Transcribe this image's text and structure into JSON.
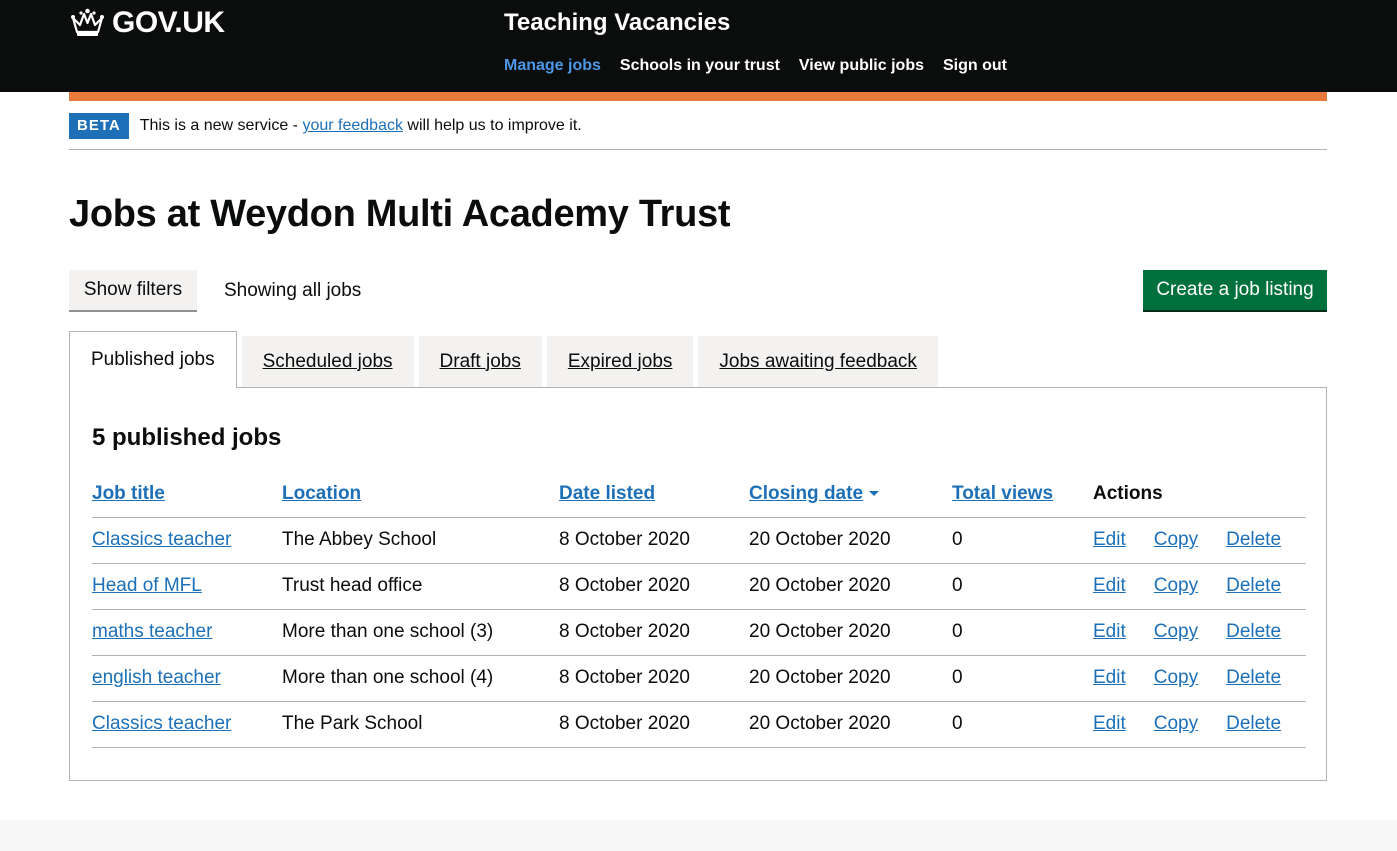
{
  "header": {
    "logo_text": "GOV.UK",
    "service_name": "Teaching Vacancies",
    "nav": [
      "Manage jobs",
      "Schools in your trust",
      "View public jobs",
      "Sign out"
    ],
    "active_nav": "Manage jobs"
  },
  "beta": {
    "tag": "BETA",
    "text_before": "This is a new service - ",
    "link": "your feedback",
    "text_after": " will help us to improve it."
  },
  "page_title": "Jobs at Weydon Multi Academy Trust",
  "filters": {
    "button": "Show filters",
    "status": "Showing all jobs"
  },
  "create_button": "Create a job listing",
  "tabs": [
    "Published jobs",
    "Scheduled jobs",
    "Draft jobs",
    "Expired jobs",
    "Jobs awaiting feedback"
  ],
  "active_tab": "Published jobs",
  "panel": {
    "title": "5 published jobs",
    "columns": [
      "Job title",
      "Location",
      "Date listed",
      "Closing date",
      "Total views",
      "Actions"
    ],
    "sorted_column": "Closing date",
    "rows": [
      {
        "title": "Classics teacher",
        "location": "The Abbey School",
        "listed": "8 October 2020",
        "closing": "20 October 2020",
        "views": "0"
      },
      {
        "title": "Head of MFL",
        "location": "Trust head office",
        "listed": "8 October 2020",
        "closing": "20 October 2020",
        "views": "0"
      },
      {
        "title": "maths teacher",
        "location": "More than one school (3)",
        "listed": "8 October 2020",
        "closing": "20 October 2020",
        "views": "0"
      },
      {
        "title": "english teacher",
        "location": "More than one school (4)",
        "listed": "8 October 2020",
        "closing": "20 October 2020",
        "views": "0"
      },
      {
        "title": "Classics teacher",
        "location": "The Park School",
        "listed": "8 October 2020",
        "closing": "20 October 2020",
        "views": "0"
      }
    ],
    "actions": [
      "Edit",
      "Copy",
      "Delete"
    ]
  },
  "colors": {
    "header_bg": "#0b0c0c",
    "link": "#1d70b8",
    "active_nav": "#4c97e6",
    "orange_bar": "#e87b3b",
    "create_button": "#00703c"
  },
  "icons": [
    "crown-icon",
    "sort-descending-icon"
  ]
}
